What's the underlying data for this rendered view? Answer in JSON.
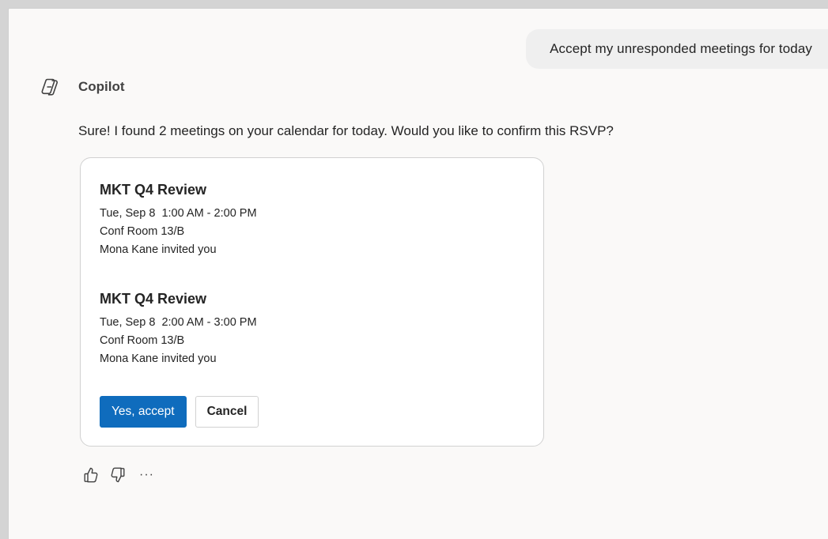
{
  "user_message": "Accept my unresponded meetings for today",
  "assistant": {
    "name": "Copilot",
    "message": "Sure! I found 2 meetings on your calendar for today. Would you like to confirm this RSVP?"
  },
  "meetings": [
    {
      "title": "MKT Q4 Review",
      "time": "Tue, Sep 8  1:00 AM - 2:00 PM",
      "location": "Conf Room 13/B",
      "organizer": "Mona Kane invited you"
    },
    {
      "title": "MKT Q4 Review",
      "time": "Tue, Sep 8  2:00 AM - 3:00 PM",
      "location": "Conf Room 13/B",
      "organizer": "Mona Kane invited you"
    }
  ],
  "actions": {
    "accept_label": "Yes, accept",
    "cancel_label": "Cancel"
  },
  "feedback": {
    "thumbs_up_icon": "thumbs-up-icon",
    "thumbs_down_icon": "thumbs-down-icon",
    "more_label": "···"
  },
  "colors": {
    "primary": "#0f6cbd",
    "text": "#242424",
    "bubble": "#efefef"
  }
}
